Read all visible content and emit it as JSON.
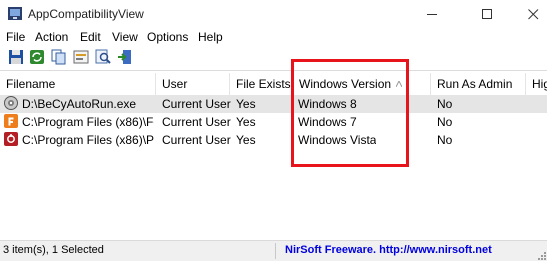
{
  "window": {
    "title": "AppCompatibilityView"
  },
  "menu": [
    "File",
    "Action",
    "Edit",
    "View",
    "Options",
    "Help"
  ],
  "toolbar": [
    {
      "icon": "save-icon"
    },
    {
      "icon": "refresh-icon"
    },
    {
      "icon": "copy-icon"
    },
    {
      "icon": "properties-icon"
    },
    {
      "icon": "find-icon"
    },
    {
      "icon": "exit-icon"
    }
  ],
  "columns": [
    "Filename",
    "User",
    "File Exists",
    "Windows Version",
    "Run As Admin",
    "Hig"
  ],
  "rows": [
    {
      "filename": "D:\\BeCyAutoRun.exe",
      "user": "Current User",
      "exists": "Yes",
      "version": "Windows 8",
      "admin": "No",
      "icon": "disc-icon",
      "selected": true
    },
    {
      "filename": "C:\\Program Files (x86)\\Fo...",
      "user": "Current User",
      "exists": "Yes",
      "version": "Windows 7",
      "admin": "No",
      "icon": "orange-app-icon",
      "selected": false
    },
    {
      "filename": "C:\\Program Files (x86)\\PD...",
      "user": "Current User",
      "exists": "Yes",
      "version": "Windows Vista",
      "admin": "No",
      "icon": "red-app-icon",
      "selected": false
    }
  ],
  "status": {
    "items": "3 item(s), 1 Selected",
    "link": "NirSoft Freeware.  http://www.nirsoft.net"
  },
  "colors": {
    "highlight": "#e8141b",
    "link": "#0000e0"
  }
}
